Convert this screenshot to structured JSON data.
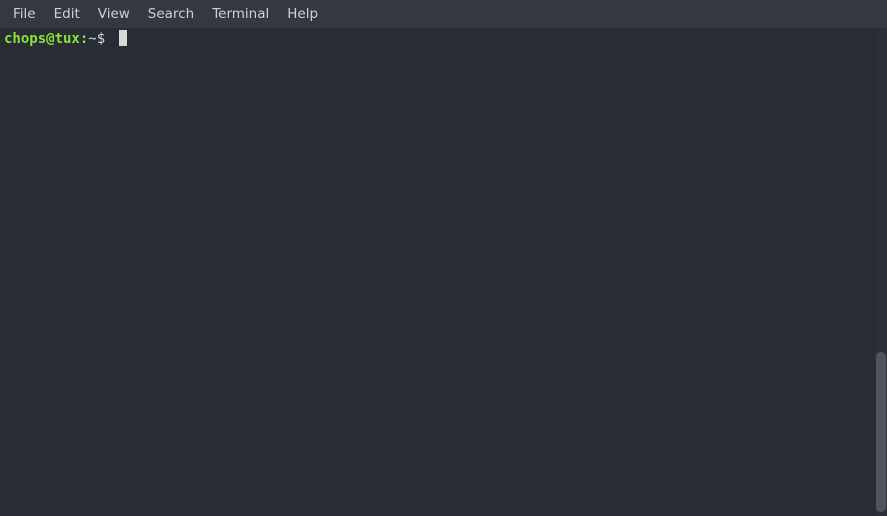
{
  "menubar": {
    "items": [
      {
        "label": "File"
      },
      {
        "label": "Edit"
      },
      {
        "label": "View"
      },
      {
        "label": "Search"
      },
      {
        "label": "Terminal"
      },
      {
        "label": "Help"
      }
    ]
  },
  "terminal": {
    "prompt": {
      "user_host": "chops@tux",
      "separator": ":",
      "path": "~",
      "sigil": "$ "
    },
    "input": ""
  },
  "colors": {
    "bg": "#282c34",
    "menubar_bg": "#333842",
    "text": "#d8d8d8",
    "prompt_green": "#8ae234",
    "scrollbar_thumb": "#4e5460"
  }
}
